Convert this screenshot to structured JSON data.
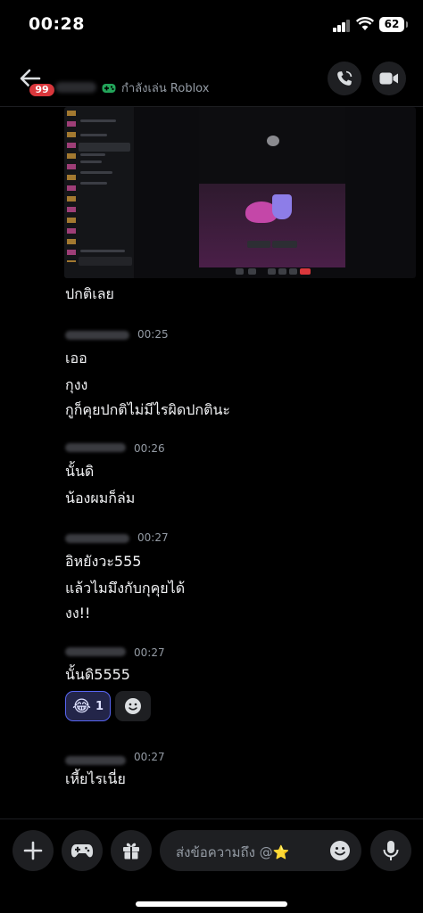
{
  "status_bar": {
    "time": "00:28",
    "battery": "62"
  },
  "header": {
    "unread_count": "99",
    "activity": "กำลังเล่น Roblox",
    "icons": {
      "back": "back-arrow-icon",
      "game": "gamepad-icon",
      "call": "phone-icon",
      "video": "video-camera-icon"
    }
  },
  "messages": [
    {
      "text": "ปกติเลย"
    },
    {
      "time": "00:25",
      "lines": [
        "เออ",
        "กุงง",
        "กูก็คุยปกติไม่มีไรผิดปกตินะ"
      ]
    },
    {
      "time": "00:26",
      "lines": [
        "นั้นดิ",
        "น้องผมก็ล่ม"
      ]
    },
    {
      "time": "00:27",
      "lines": [
        "อิหยังวะ555",
        "แล้วไมมึงกับกุคุยได้",
        "งง!!"
      ]
    },
    {
      "time": "00:27",
      "lines": [
        "นั้นดิ5555"
      ],
      "reaction": {
        "emoji": "😂",
        "count": "1"
      }
    },
    {
      "time": "00:27",
      "lines": [
        "เหี้ยไรเนี่ย"
      ]
    }
  ],
  "input_bar": {
    "placeholder": "ส่งข้อความถึง @⭐",
    "icons": {
      "add": "plus-icon",
      "games": "gamepad-icon",
      "gift": "gift-icon",
      "emoji": "smiley-icon",
      "mic": "microphone-icon"
    }
  },
  "colors": {
    "accent": "#5865f2",
    "badge": "#da373c",
    "game_green": "#23a55a",
    "muted": "#949ba4"
  }
}
